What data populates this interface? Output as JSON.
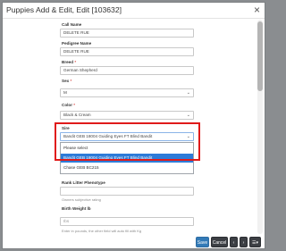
{
  "modal": {
    "title": "Puppies Add & Edit, Edit [103632]",
    "close_glyph": "×"
  },
  "form": {
    "call_name": {
      "label": "Call Name",
      "value": "DELETE RUE"
    },
    "pedigree_name": {
      "label": "Pedigree Name",
      "value": "DELETE RUE"
    },
    "breed": {
      "label": "Breed",
      "required_mark": "*",
      "value": "German Shepherd"
    },
    "sex": {
      "label": "Sex",
      "required_mark": "*",
      "value": "M"
    },
    "color": {
      "label": "Color",
      "required_mark": "*",
      "value": "Black & Cream"
    },
    "sire": {
      "label": "Sire",
      "value": "Bandit GEB 18004 Guiding Eyes FT Blind Bandit",
      "options": [
        {
          "label": "Please select",
          "selected": false
        },
        {
          "label": "Bandit GEB 18004 Guiding Eyes FT Blind Bandit",
          "selected": true
        },
        {
          "label": "Chase GEB BC215",
          "selected": false
        }
      ]
    },
    "rank_litter_phenotype": {
      "label": "Rank Litter Phenotype",
      "value": "",
      "hint": "Owners subjective rating"
    },
    "birth_weight": {
      "label": "Birth Weight lb",
      "placeholder": "Ibs",
      "hint": "Enter in pounds, the other field will auto fill with Kg"
    }
  },
  "footer": {
    "save_label": "Save",
    "cancel_label": "Cancel",
    "prev_glyph": "‹",
    "next_glyph": "›",
    "menu_glyph": "☰▾"
  },
  "colors": {
    "highlight": "#e01a1a",
    "selected_option": "#2d7bd8",
    "primary_button": "#337ab7"
  }
}
